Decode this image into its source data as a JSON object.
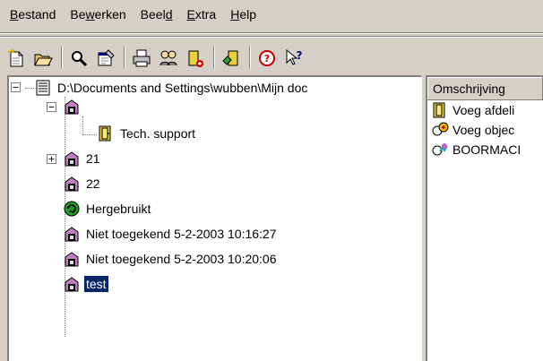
{
  "menu": [
    {
      "label": "Bestand",
      "accel": "B"
    },
    {
      "label": "Bewerken",
      "accel": "w"
    },
    {
      "label": "Beeld",
      "accel": "d"
    },
    {
      "label": "Extra",
      "accel": "E"
    },
    {
      "label": "Help",
      "accel": "H"
    }
  ],
  "toolbar": {
    "buttons": [
      "new-document-icon",
      "open-folder-icon",
      "search-icon",
      "properties-icon",
      "print-icon",
      "users-icon",
      "add-door-icon",
      "edit-door-icon",
      "help-icon",
      "context-help-icon"
    ]
  },
  "tree": {
    "root": {
      "label": "D:\\Documents and Settings\\wubben\\Mijn doc",
      "icon": "database-icon"
    },
    "nodes": [
      {
        "label": "",
        "icon": "building-icon",
        "expander": "−"
      },
      {
        "label": "Tech. support",
        "icon": "door-icon"
      },
      {
        "label": "21",
        "icon": "building-icon",
        "expander": "+"
      },
      {
        "label": "22",
        "icon": "building-icon"
      },
      {
        "label": "Hergebruikt",
        "icon": "recycle-icon"
      },
      {
        "label": "Niet toegekend  5-2-2003  10:16:27",
        "icon": "building-icon"
      },
      {
        "label": "Niet toegekend  5-2-2003  10:20:06",
        "icon": "building-icon"
      },
      {
        "label": "test",
        "icon": "building-icon",
        "selected": true
      }
    ]
  },
  "list": {
    "header": "Omschrijving",
    "items": [
      {
        "label": "Voeg afdeli",
        "icon": "door-icon"
      },
      {
        "label": "Voeg objec",
        "icon": "add-object-icon"
      },
      {
        "label": "BOORMACI",
        "icon": "drill-icon"
      }
    ]
  },
  "colors": {
    "selection": "#0a246a",
    "face": "#d4d0c8",
    "shadow": "#808080"
  }
}
